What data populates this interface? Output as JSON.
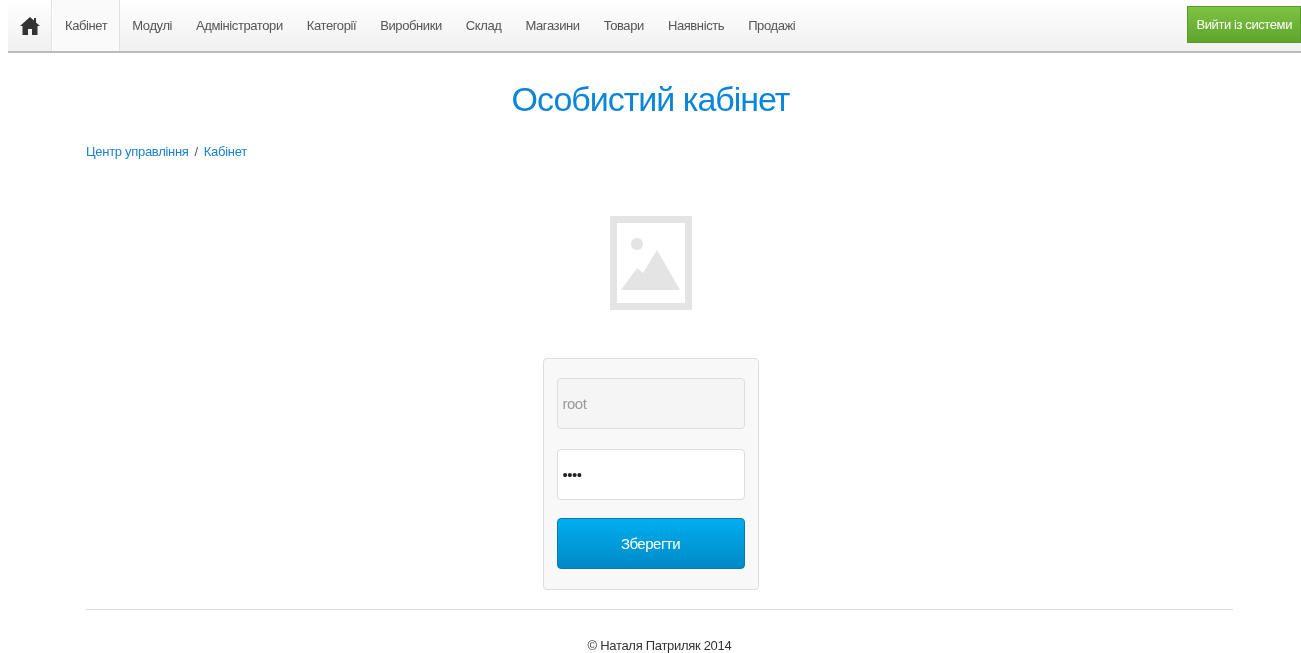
{
  "navbar": {
    "items": [
      {
        "label": "Кабінет",
        "selected": true
      },
      {
        "label": "Модулі",
        "selected": false
      },
      {
        "label": "Адміністратори",
        "selected": false
      },
      {
        "label": "Категорії",
        "selected": false
      },
      {
        "label": "Виробники",
        "selected": false
      },
      {
        "label": "Склад",
        "selected": false
      },
      {
        "label": "Магазини",
        "selected": false
      },
      {
        "label": "Товари",
        "selected": false
      },
      {
        "label": "Наявність",
        "selected": false
      },
      {
        "label": "Продажі",
        "selected": false
      }
    ],
    "logout_button": "Вийти із системи"
  },
  "page_title": "Особистий кабінет",
  "breadcrumb": [
    "Центр управління",
    "Кабінет"
  ],
  "breadcrumb_separator": "/",
  "form": {
    "login": {
      "value": "root",
      "disabled": true
    },
    "password": {
      "value": "••••",
      "disabled": false
    },
    "submit_button": "Зберегти"
  },
  "footer": "© Наталя Патриляк 2014"
}
